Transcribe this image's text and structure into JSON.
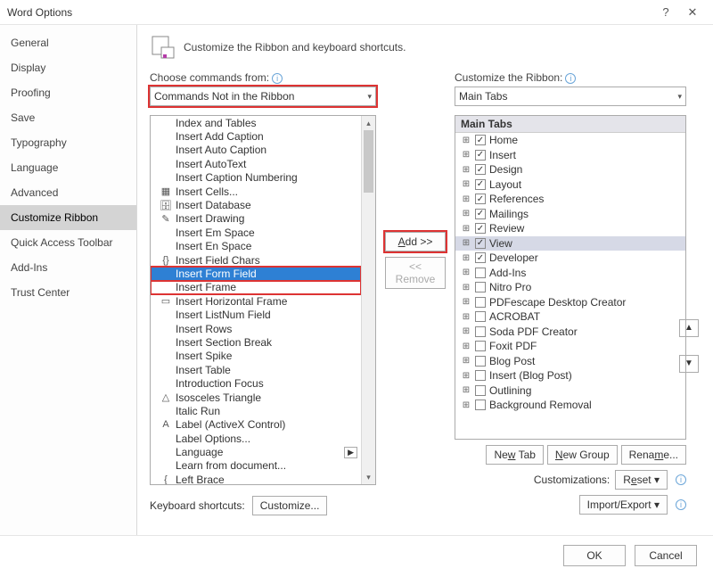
{
  "window": {
    "title": "Word Options",
    "help": "?",
    "close": "✕"
  },
  "sidebar": {
    "items": [
      "General",
      "Display",
      "Proofing",
      "Save",
      "Typography",
      "Language",
      "Advanced",
      "Customize Ribbon",
      "Quick Access Toolbar",
      "Add-Ins",
      "Trust Center"
    ],
    "activeIndex": 7
  },
  "header": "Customize the Ribbon and keyboard shortcuts.",
  "left": {
    "label": "Choose commands from:",
    "select": "Commands Not in the Ribbon",
    "items": [
      {
        "t": "Index and Tables",
        "i": ""
      },
      {
        "t": "Insert Add Caption",
        "i": ""
      },
      {
        "t": "Insert Auto Caption",
        "i": ""
      },
      {
        "t": "Insert AutoText",
        "i": ""
      },
      {
        "t": "Insert Caption Numbering",
        "i": ""
      },
      {
        "t": "Insert Cells...",
        "i": "▦"
      },
      {
        "t": "Insert Database",
        "i": "🗄"
      },
      {
        "t": "Insert Drawing",
        "i": "✎"
      },
      {
        "t": "Insert Em Space",
        "i": ""
      },
      {
        "t": "Insert En Space",
        "i": ""
      },
      {
        "t": "Insert Field Chars",
        "i": "{}"
      },
      {
        "t": "Insert Form Field",
        "i": "",
        "selected": true,
        "boxed": true
      },
      {
        "t": "Insert Frame",
        "i": "",
        "boxed": true
      },
      {
        "t": "Insert Horizontal Frame",
        "i": "▭"
      },
      {
        "t": "Insert ListNum Field",
        "i": ""
      },
      {
        "t": "Insert Rows",
        "i": ""
      },
      {
        "t": "Insert Section Break",
        "i": ""
      },
      {
        "t": "Insert Spike",
        "i": ""
      },
      {
        "t": "Insert Table",
        "i": ""
      },
      {
        "t": "Introduction Focus",
        "i": ""
      },
      {
        "t": "Isosceles Triangle",
        "i": "△"
      },
      {
        "t": "Italic Run",
        "i": ""
      },
      {
        "t": "Label (ActiveX Control)",
        "i": "A"
      },
      {
        "t": "Label Options...",
        "i": ""
      },
      {
        "t": "Language",
        "i": "",
        "drop": true
      },
      {
        "t": "Learn from document...",
        "i": ""
      },
      {
        "t": "Left Brace",
        "i": "{"
      }
    ]
  },
  "mid": {
    "add": "Add >>",
    "remove": "<< Remove"
  },
  "right": {
    "label": "Customize the Ribbon:",
    "select": "Main Tabs",
    "treeHead": "Main Tabs",
    "items": [
      {
        "t": "Home",
        "c": true
      },
      {
        "t": "Insert",
        "c": true
      },
      {
        "t": "Design",
        "c": true
      },
      {
        "t": "Layout",
        "c": true
      },
      {
        "t": "References",
        "c": true
      },
      {
        "t": "Mailings",
        "c": true
      },
      {
        "t": "Review",
        "c": true
      },
      {
        "t": "View",
        "c": true,
        "selected": true
      },
      {
        "t": "Developer",
        "c": true
      },
      {
        "t": "Add-Ins",
        "c": false
      },
      {
        "t": "Nitro Pro",
        "c": false
      },
      {
        "t": "PDFescape Desktop Creator",
        "c": false
      },
      {
        "t": "ACROBAT",
        "c": false
      },
      {
        "t": "Soda PDF Creator",
        "c": false
      },
      {
        "t": "Foxit PDF",
        "c": false
      },
      {
        "t": "Blog Post",
        "c": false
      },
      {
        "t": "Insert (Blog Post)",
        "c": false
      },
      {
        "t": "Outlining",
        "c": false
      },
      {
        "t": "Background Removal",
        "c": false
      }
    ],
    "newTab": "New Tab",
    "newGroup": "New Group",
    "rename": "Rename...",
    "custLabel": "Customizations:",
    "reset": "Reset ▾",
    "importExport": "Import/Export ▾"
  },
  "kbs": {
    "label": "Keyboard shortcuts:",
    "btn": "Customize..."
  },
  "footer": {
    "ok": "OK",
    "cancel": "Cancel"
  }
}
